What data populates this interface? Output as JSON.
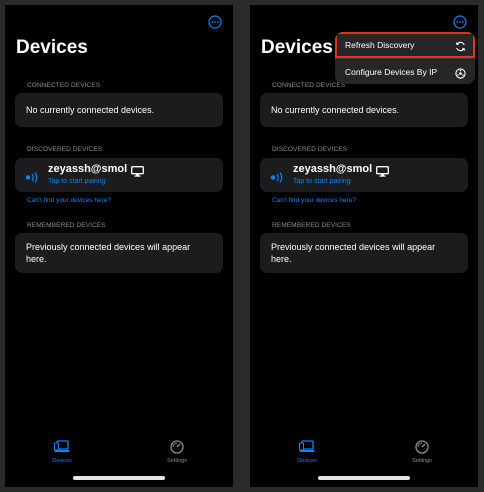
{
  "screens": [
    {
      "title": "Devices",
      "connected": {
        "label": "CONNECTED DEVICES",
        "empty_text": "No currently connected devices."
      },
      "discovered": {
        "label": "DISCOVERED DEVICES",
        "device_name": "zeyassh@smol",
        "device_sub": "Tap to start pairing",
        "help_link": "Can't find your devices here?"
      },
      "remembered": {
        "label": "REMEMBERED DEVICES",
        "empty_text": "Previously connected devices will appear here."
      },
      "tabs": {
        "devices": "Devices",
        "settings": "Settings"
      }
    },
    {
      "title": "Devices",
      "connected": {
        "label": "CONNECTED DEVICES",
        "empty_text": "No currently connected devices."
      },
      "discovered": {
        "label": "DISCOVERED DEVICES",
        "device_name": "zeyassh@smol",
        "device_sub": "Tap to start pairing",
        "help_link": "Can't find your devices here?"
      },
      "remembered": {
        "label": "REMEMBERED DEVICES",
        "empty_text": "Previously connected devices will appear here."
      },
      "tabs": {
        "devices": "Devices",
        "settings": "Settings"
      },
      "menu": {
        "refresh": "Refresh Discovery",
        "configure": "Configure Devices By IP"
      }
    }
  ],
  "colors": {
    "accent": "#0a84ff",
    "card": "#1c1c1e",
    "highlight": "#e0321c"
  }
}
